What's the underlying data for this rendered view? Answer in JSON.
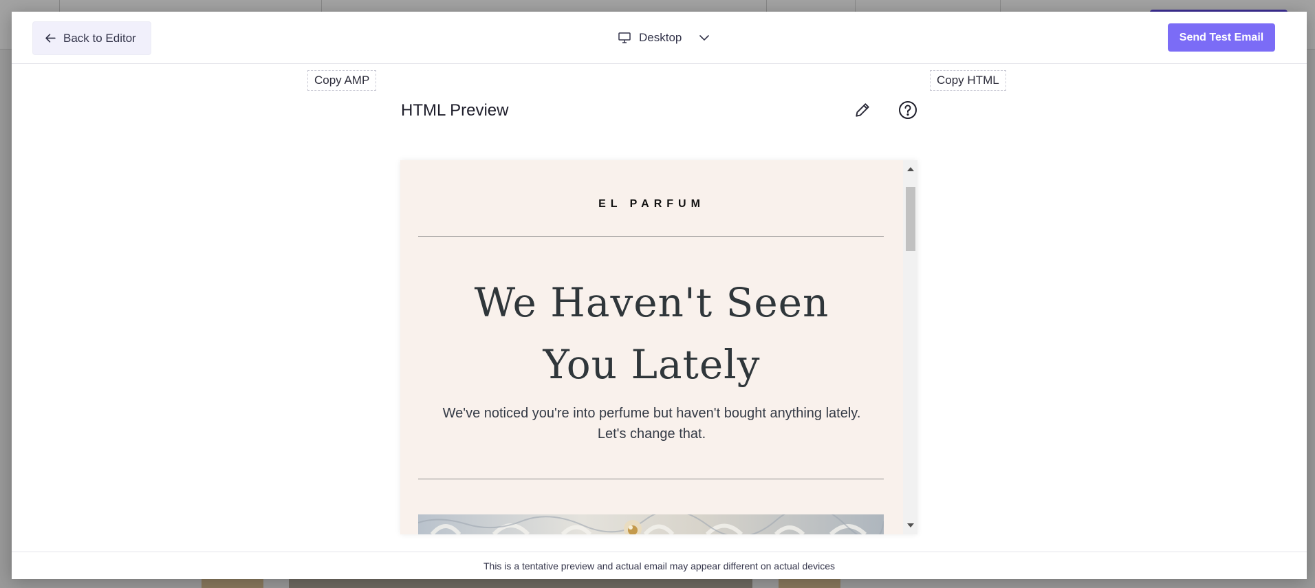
{
  "header": {
    "back_label": "Back to Editor",
    "device_label": "Desktop",
    "send_label": "Send Test Email"
  },
  "toolbar": {
    "copy_amp_label": "Copy AMP",
    "copy_html_label": "Copy HTML",
    "preview_title": "HTML Preview"
  },
  "email": {
    "brand": "EL PARFUM",
    "headline_line1": "We Haven't Seen",
    "headline_line2": "You Lately",
    "subtext_line1": "We've noticed you're into perfume but haven't bought anything lately.",
    "subtext_line2": "Let's change that."
  },
  "footer": {
    "note": "This is a tentative preview and actual email may appear different on actual devices"
  },
  "colors": {
    "accent": "#7b6cf6",
    "email_background": "#f9f1ec",
    "back_button_background": "#f1f0fb"
  },
  "icons": {
    "back": "arrow-left-icon",
    "device": "monitor-icon",
    "dropdown": "chevron-down-icon",
    "edit": "pencil-icon",
    "help": "question-circle-icon"
  }
}
